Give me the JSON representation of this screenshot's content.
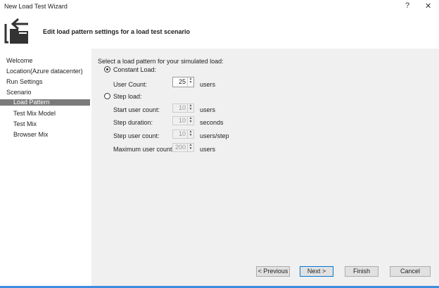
{
  "window": {
    "title": "New Load Test Wizard",
    "help": "?",
    "close": "✕"
  },
  "header": {
    "text": "Edit load pattern settings for a load test scenario",
    "icon": "wizard-arrow-folder-icon"
  },
  "nav": {
    "items": [
      {
        "label": "Welcome",
        "sub": false
      },
      {
        "label": "Location(Azure datacenter)",
        "sub": false
      },
      {
        "label": "Run Settings",
        "sub": false
      },
      {
        "label": "Scenario",
        "sub": false
      },
      {
        "label": "Load Pattern",
        "sub": true,
        "selected": true
      },
      {
        "label": "Test Mix Model",
        "sub": true
      },
      {
        "label": "Test Mix",
        "sub": true
      },
      {
        "label": "Browser Mix",
        "sub": true
      }
    ]
  },
  "main": {
    "prompt": "Select a load pattern for your simulated load:",
    "constant": {
      "label": "Constant Load:",
      "selected": true,
      "user_count_label": "User Count:",
      "user_count": "25",
      "unit": "users"
    },
    "step": {
      "label": "Step load:",
      "selected": false,
      "fields": [
        {
          "label": "Start user count:",
          "value": "10",
          "unit": "users"
        },
        {
          "label": "Step duration:",
          "value": "10",
          "unit": "seconds"
        },
        {
          "label": "Step user count:",
          "value": "10",
          "unit": "users/step"
        },
        {
          "label": "Maximum user count:",
          "value": "200",
          "unit": "users"
        }
      ]
    }
  },
  "buttons": {
    "previous": "< Previous",
    "next": "Next >",
    "finish": "Finish",
    "cancel": "Cancel"
  },
  "colors": {
    "selection": "#7b7b7b",
    "panel": "#f0f0f0",
    "accent": "#0078d7"
  }
}
